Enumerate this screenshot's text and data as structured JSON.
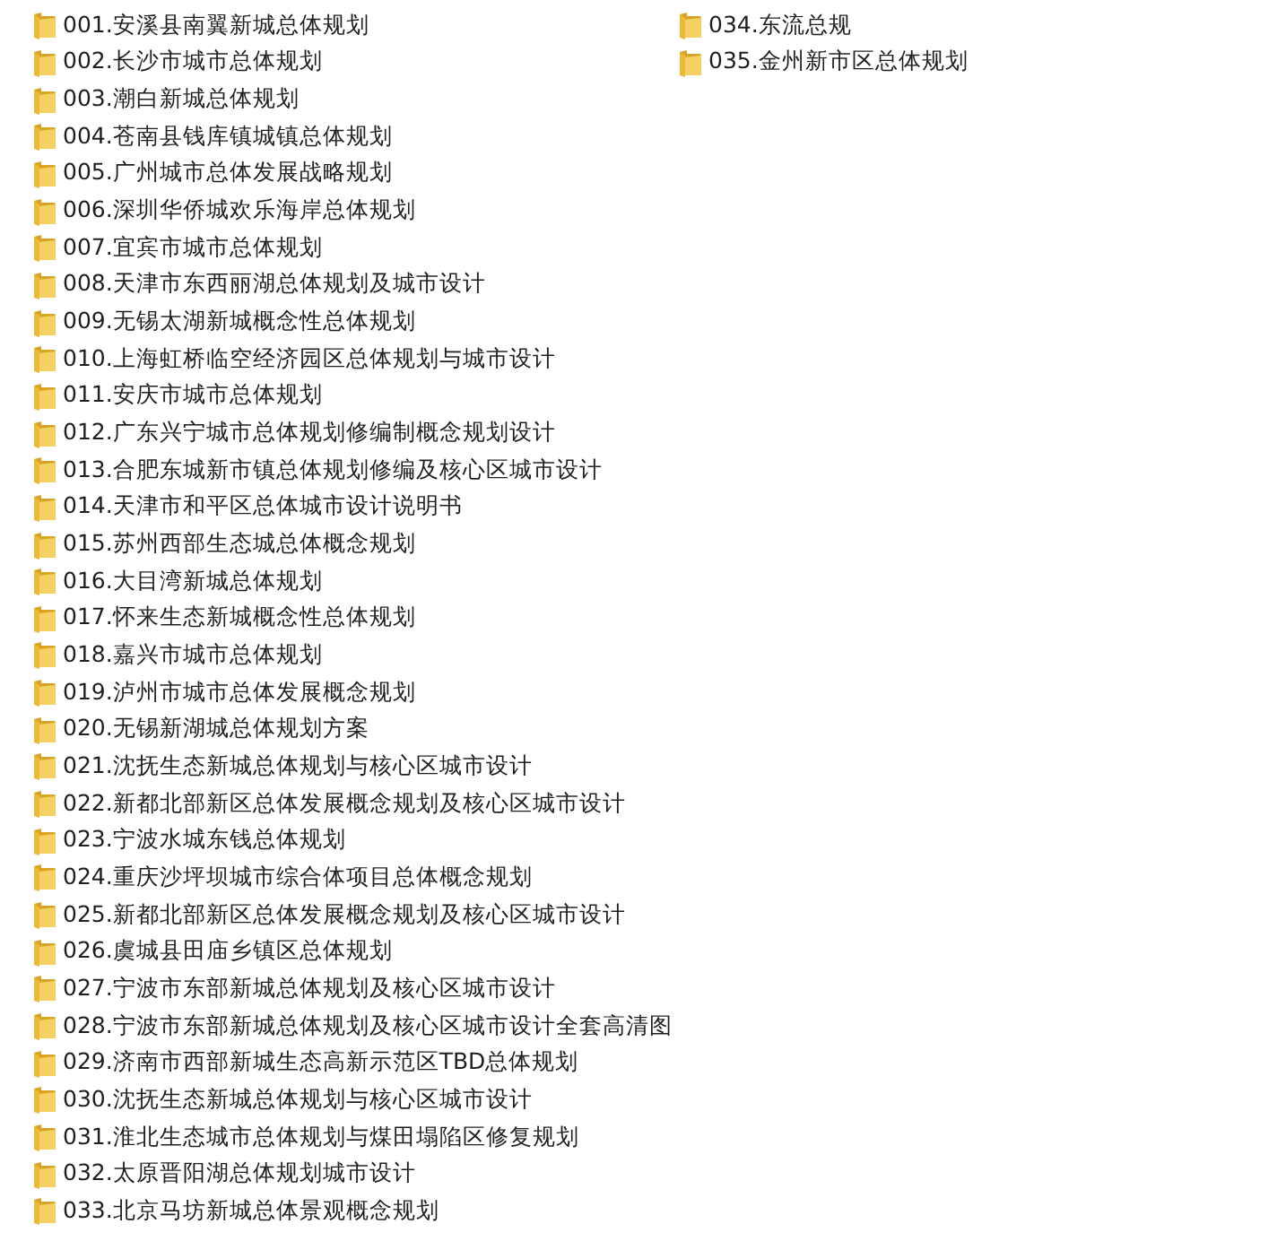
{
  "folders": [
    {
      "name": "001.安溪县南翼新城总体规划"
    },
    {
      "name": "002.长沙市城市总体规划"
    },
    {
      "name": "003.潮白新城总体规划"
    },
    {
      "name": "004.苍南县钱库镇城镇总体规划"
    },
    {
      "name": "005.广州城市总体发展战略规划"
    },
    {
      "name": "006.深圳华侨城欢乐海岸总体规划"
    },
    {
      "name": "007.宜宾市城市总体规划"
    },
    {
      "name": "008.天津市东西丽湖总体规划及城市设计"
    },
    {
      "name": "009.无锡太湖新城概念性总体规划"
    },
    {
      "name": "010.上海虹桥临空经济园区总体规划与城市设计"
    },
    {
      "name": "011.安庆市城市总体规划"
    },
    {
      "name": "012.广东兴宁城市总体规划修编制概念规划设计"
    },
    {
      "name": "013.合肥东城新市镇总体规划修编及核心区城市设计"
    },
    {
      "name": "014.天津市和平区总体城市设计说明书"
    },
    {
      "name": "015.苏州西部生态城总体概念规划"
    },
    {
      "name": "016.大目湾新城总体规划"
    },
    {
      "name": "017.怀来生态新城概念性总体规划"
    },
    {
      "name": "018.嘉兴市城市总体规划"
    },
    {
      "name": "019.泸州市城市总体发展概念规划"
    },
    {
      "name": "020.无锡新湖城总体规划方案"
    },
    {
      "name": "021.沈抚生态新城总体规划与核心区城市设计"
    },
    {
      "name": "022.新都北部新区总体发展概念规划及核心区城市设计"
    },
    {
      "name": "023.宁波水城东钱总体规划"
    },
    {
      "name": "024.重庆沙坪坝城市综合体项目总体概念规划"
    },
    {
      "name": "025.新都北部新区总体发展概念规划及核心区城市设计"
    },
    {
      "name": "026.虞城县田庙乡镇区总体规划"
    },
    {
      "name": "027.宁波市东部新城总体规划及核心区城市设计"
    },
    {
      "name": "028.宁波市东部新城总体规划及核心区城市设计全套高清图"
    },
    {
      "name": "029.济南市西部新城生态高新示范区TBD总体规划"
    },
    {
      "name": "030.沈抚生态新城总体规划与核心区城市设计"
    },
    {
      "name": "031.淮北生态城市总体规划与煤田塌陷区修复规划"
    },
    {
      "name": "032.太原晋阳湖总体规划城市设计"
    },
    {
      "name": "033.北京马坊新城总体景观概念规划"
    },
    {
      "name": "034.东流总规"
    },
    {
      "name": "035.金州新市区总体规划"
    }
  ]
}
